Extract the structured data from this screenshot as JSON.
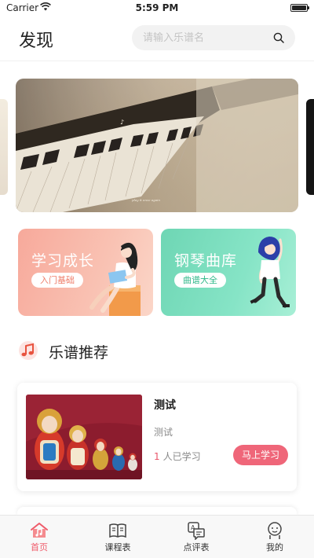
{
  "status_bar": {
    "carrier": "Carrier",
    "time": "5:59 PM"
  },
  "header": {
    "title": "发现",
    "search_placeholder": "请输入乐谱名"
  },
  "banner": {
    "caption": "play it once again"
  },
  "categories": [
    {
      "title": "学习成长",
      "tag": "入门基础",
      "color": "#f7a99b"
    },
    {
      "title": "钢琴曲库",
      "tag": "曲谱大全",
      "color": "#6ed6b4"
    }
  ],
  "section": {
    "title": "乐谱推荐"
  },
  "scores": [
    {
      "title": "测试",
      "description": "测试",
      "learner_count": "1",
      "learner_suffix": "人已学习",
      "action": "马上学习"
    }
  ],
  "tabs": [
    {
      "label": "首页",
      "icon": "home-music-icon",
      "active": true
    },
    {
      "label": "课程表",
      "icon": "book-icon",
      "active": false
    },
    {
      "label": "点评表",
      "icon": "review-chat-icon",
      "active": false
    },
    {
      "label": "我的",
      "icon": "profile-icon",
      "active": false
    }
  ],
  "colors": {
    "accent": "#ef5b6a",
    "button": "#ef6679"
  }
}
